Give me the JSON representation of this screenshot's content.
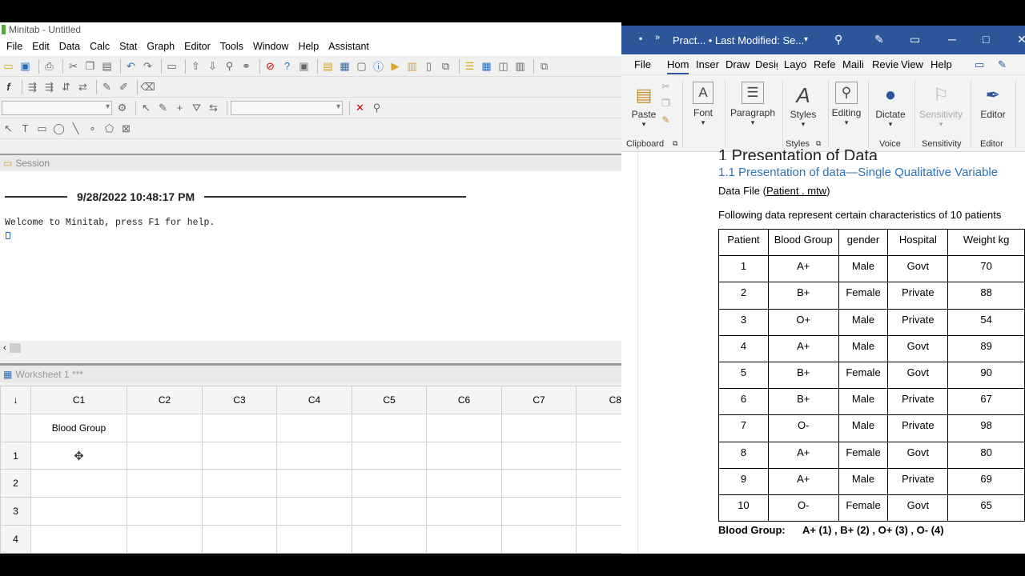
{
  "minitab": {
    "title": "Minitab - Untitled",
    "menu": [
      "File",
      "Edit",
      "Data",
      "Calc",
      "Stat",
      "Graph",
      "Editor",
      "Tools",
      "Window",
      "Help",
      "Assistant"
    ],
    "session": {
      "header": "Session",
      "datetime": "9/28/2022 10:48:17 PM",
      "welcome": "Welcome to Minitab, press F1 for help."
    },
    "worksheet": {
      "header": "Worksheet 1 ***",
      "corner": "↓",
      "columns": [
        "C1",
        "C2",
        "C3",
        "C4",
        "C5",
        "C6",
        "C7",
        "C8"
      ],
      "column_names": [
        "Blood Group",
        "",
        "",
        "",
        "",
        "",
        "",
        ""
      ],
      "rows": [
        "1",
        "2",
        "3",
        "4"
      ]
    }
  },
  "word": {
    "title": "Pract...  •  Last Modified: Se...",
    "tabs": [
      "File",
      "Hom",
      "Inser",
      "Draw",
      "Desig",
      "Layo",
      "Refer",
      "Maili",
      "Revie",
      "View",
      "Help"
    ],
    "ribbon": {
      "paste": "Paste",
      "font": "Font",
      "paragraph": "Paragraph",
      "styles": "Styles",
      "editing": "Editing",
      "dictate": "Dictate",
      "sensitivity": "Sensitivity",
      "editor": "Editor",
      "groups": {
        "clipboard": "Clipboard",
        "styles": "Styles",
        "voice": "Voice",
        "sensitivity": "Sensitivity",
        "editor": "Editor"
      }
    },
    "doc": {
      "heading1": "1   Presentation of Data",
      "heading2": "1.1    Presentation of data—Single Qualitative Variable",
      "data_file_prefix": "Data File (",
      "data_file_link": "Patient . mtw",
      "data_file_suffix": ")",
      "following": "Following data represent certain characteristics of 10 patients",
      "table_headers": [
        "Patient",
        "Blood Group",
        "gender",
        "Hospital",
        "Weight kg"
      ],
      "table_rows": [
        [
          "1",
          "A+",
          "Male",
          "Govt",
          "70"
        ],
        [
          "2",
          "B+",
          "Female",
          "Private",
          "88"
        ],
        [
          "3",
          "O+",
          "Male",
          "Private",
          "54"
        ],
        [
          "4",
          "A+",
          "Male",
          "Govt",
          "89"
        ],
        [
          "5",
          "B+",
          "Female",
          "Govt",
          "90"
        ],
        [
          "6",
          "B+",
          "Male",
          "Private",
          "67"
        ],
        [
          "7",
          "O-",
          "Male",
          "Private",
          "98"
        ],
        [
          "8",
          "A+",
          "Female",
          "Govt",
          "80"
        ],
        [
          "9",
          "A+",
          "Male",
          "Private",
          "69"
        ],
        [
          "10",
          "O-",
          "Female",
          "Govt",
          "65"
        ]
      ],
      "blood_group_label": "Blood Group:",
      "blood_group_codes": "A+ (1) , B+ (2) , O+ (3) , O- (4)"
    }
  }
}
